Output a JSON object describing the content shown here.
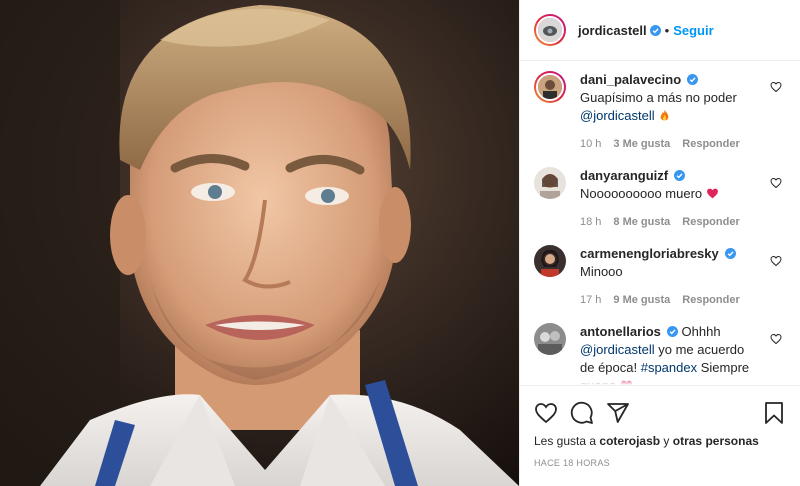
{
  "post": {
    "author": "jordicastell",
    "follow_label": "Seguir",
    "separator": "•",
    "image_alt": "Retrato de un hombre sonriente con camisa blanca y cinta azul"
  },
  "comments": [
    {
      "user": "dani_palavecino",
      "verified": true,
      "text_before": "Guapísimo a más no poder ",
      "mention": "@jordicastell",
      "text_after": " ",
      "emoji": "fire",
      "age": "10 h",
      "likes": "3 Me gusta",
      "reply": "Responder"
    },
    {
      "user": "danyaranguizf",
      "verified": true,
      "text_before": "Noooooooooo muero ",
      "emoji": "red-heart",
      "age": "18 h",
      "likes": "8 Me gusta",
      "reply": "Responder"
    },
    {
      "user": "carmenengloriabresky",
      "verified": true,
      "text_before": "Minooo",
      "age": "17 h",
      "likes": "9 Me gusta",
      "reply": "Responder"
    },
    {
      "user": "antonellarios",
      "verified": true,
      "text_before": "Ohhhh ",
      "mention": "@jordicastell",
      "text_middle": " yo me acuerdo de época! ",
      "hashtag": "#spandex",
      "text_after": " Siempre guapo ",
      "emoji": "red-heart"
    }
  ],
  "likes_text": {
    "prefix": "Les gusta a",
    "user": "coterojasb",
    "middle": "y",
    "others": "otras personas"
  },
  "timestamp": "Hace 18 horas",
  "icons": [
    "heart-icon",
    "comment-icon",
    "share-icon",
    "bookmark-icon",
    "verified-icon"
  ],
  "colors": {
    "link": "#0095f6",
    "verified": "#3897f0",
    "muted": "#8e8e8e",
    "mention": "#00376b",
    "heart": "#e0245e"
  }
}
